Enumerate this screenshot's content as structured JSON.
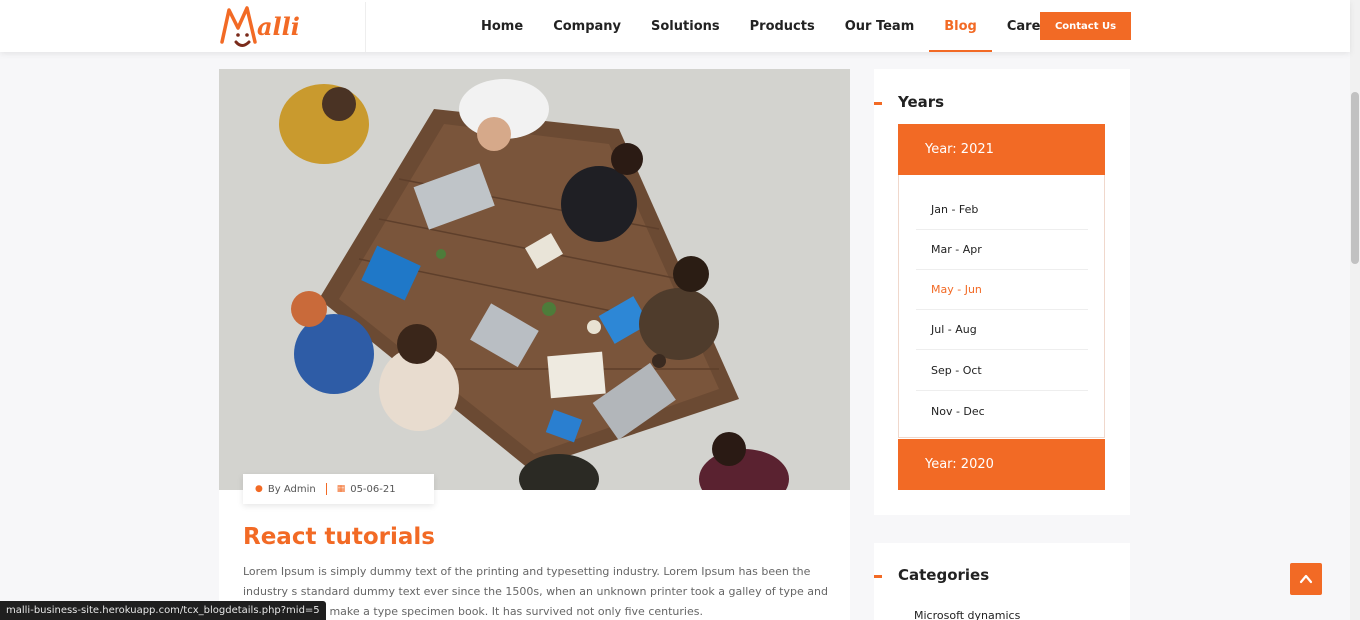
{
  "logo": {
    "text": "Malli"
  },
  "nav": {
    "items": [
      {
        "label": "Home",
        "active": false
      },
      {
        "label": "Company",
        "active": false
      },
      {
        "label": "Solutions",
        "active": false
      },
      {
        "label": "Products",
        "active": false
      },
      {
        "label": "Our Team",
        "active": false
      },
      {
        "label": "Blog",
        "active": true
      },
      {
        "label": "Careers",
        "active": false
      }
    ],
    "contact_label": "Contact Us"
  },
  "post": {
    "author": "By Admin",
    "date": "05-06-21",
    "title": "React tutorials",
    "body": "Lorem Ipsum is simply dummy text of the printing and typesetting industry. Lorem Ipsum has been the industry s standard dummy text ever since the 1500s, when an unknown printer took a galley of type and scrambled it to make a type specimen book. It has survived not only five centuries."
  },
  "sidebar": {
    "years_title": "Years",
    "years": [
      {
        "label": "Year: 2021",
        "months": [
          "Jan - Feb",
          "Mar - Apr",
          "May - Jun",
          "Jul - Aug",
          "Sep - Oct",
          "Nov - Dec"
        ],
        "active_month": "May - Jun"
      },
      {
        "label": "Year: 2020"
      }
    ],
    "categories_title": "Categories",
    "categories": [
      "Microsoft dynamics"
    ]
  },
  "status_bar": {
    "url": "malli-business-site.herokuapp.com/tcx_blogdetails.php?mid=5"
  },
  "colors": {
    "accent": "#f26a25",
    "text": "#222222",
    "muted": "#666666"
  },
  "icons": {
    "author": "user-icon",
    "date": "calendar-icon",
    "back_to_top": "chevron-up-icon"
  }
}
